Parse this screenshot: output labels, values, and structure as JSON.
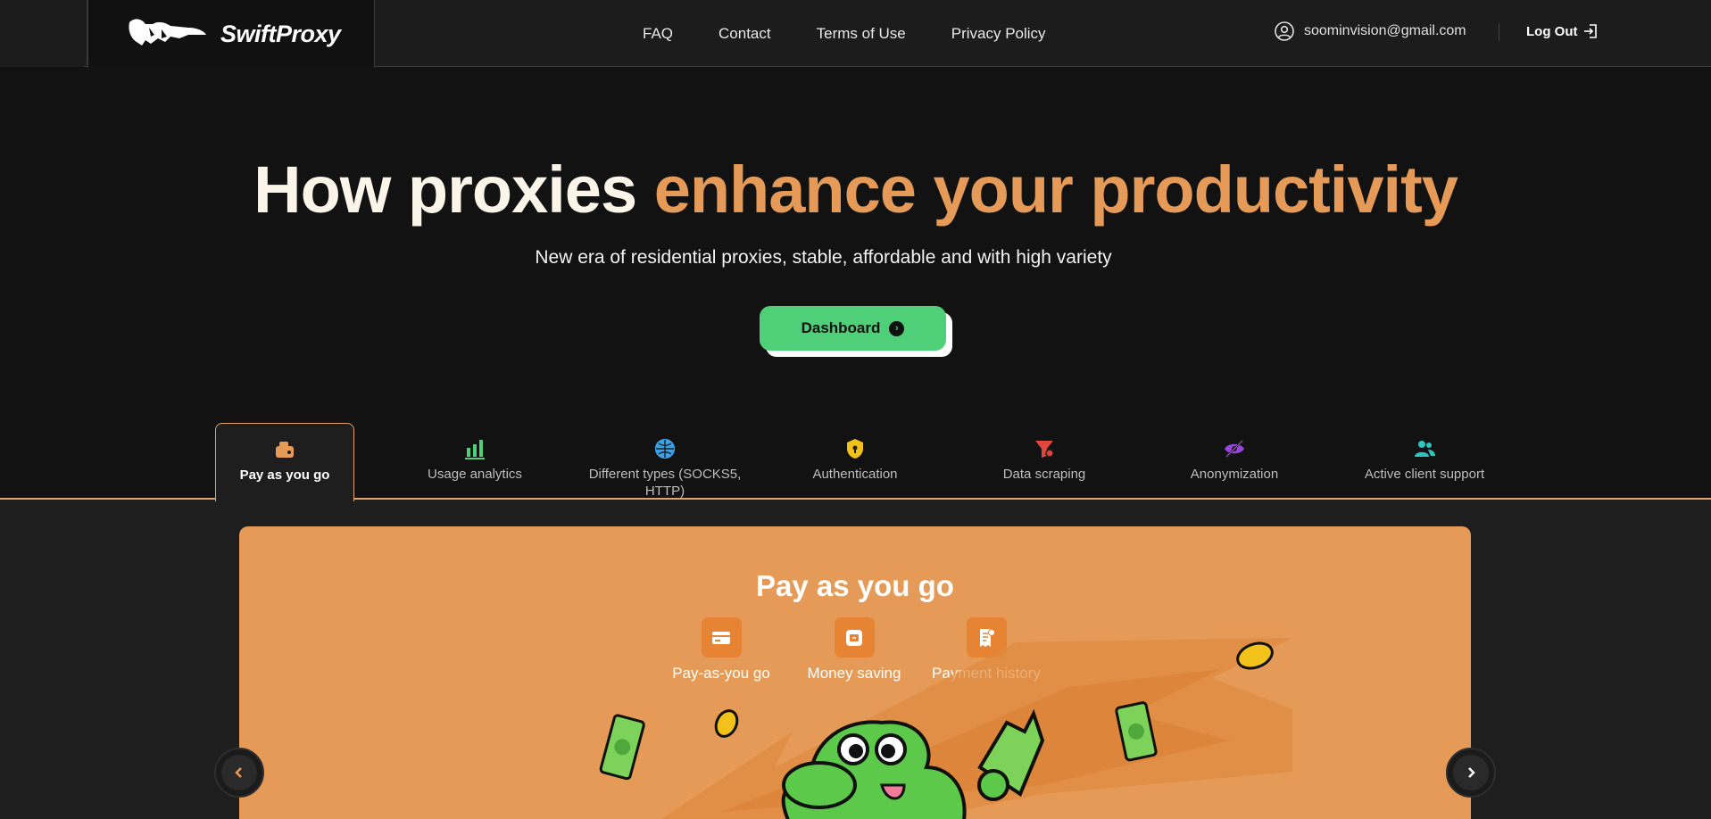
{
  "brand": {
    "name": "SwiftProxy"
  },
  "nav": {
    "links": [
      "FAQ",
      "Contact",
      "Terms of Use",
      "Privacy Policy"
    ],
    "user_email": "soominvision@gmail.com",
    "logout_label": "Log Out"
  },
  "hero": {
    "title_plain": "How proxies ",
    "title_accent": "enhance your productivity",
    "subtitle": "New era of residential proxies, stable, affordable and with high variety",
    "dashboard_label": "Dashboard"
  },
  "tabs": [
    {
      "label": "Pay as you go",
      "icon": "wallet-icon",
      "active": true
    },
    {
      "label": "Usage analytics",
      "icon": "bar-chart-icon"
    },
    {
      "label": "Different types (SOCKS5, HTTP)",
      "icon": "globe-icon"
    },
    {
      "label": "Authentication",
      "icon": "shield-lock-icon"
    },
    {
      "label": "Data scraping",
      "icon": "funnel-icon"
    },
    {
      "label": "Anonymization",
      "icon": "eye-off-icon"
    },
    {
      "label": "Active client support",
      "icon": "users-icon"
    }
  ],
  "card": {
    "title": "Pay as you go",
    "features": [
      {
        "label": "Pay-as-you go",
        "icon": "card-icon"
      },
      {
        "label": "Money saving",
        "icon": "savings-icon"
      },
      {
        "label": "Payment history",
        "icon": "receipt-icon"
      }
    ]
  },
  "colors": {
    "accent": "#e59b57",
    "green": "#4fcf78",
    "background": "#121212"
  }
}
